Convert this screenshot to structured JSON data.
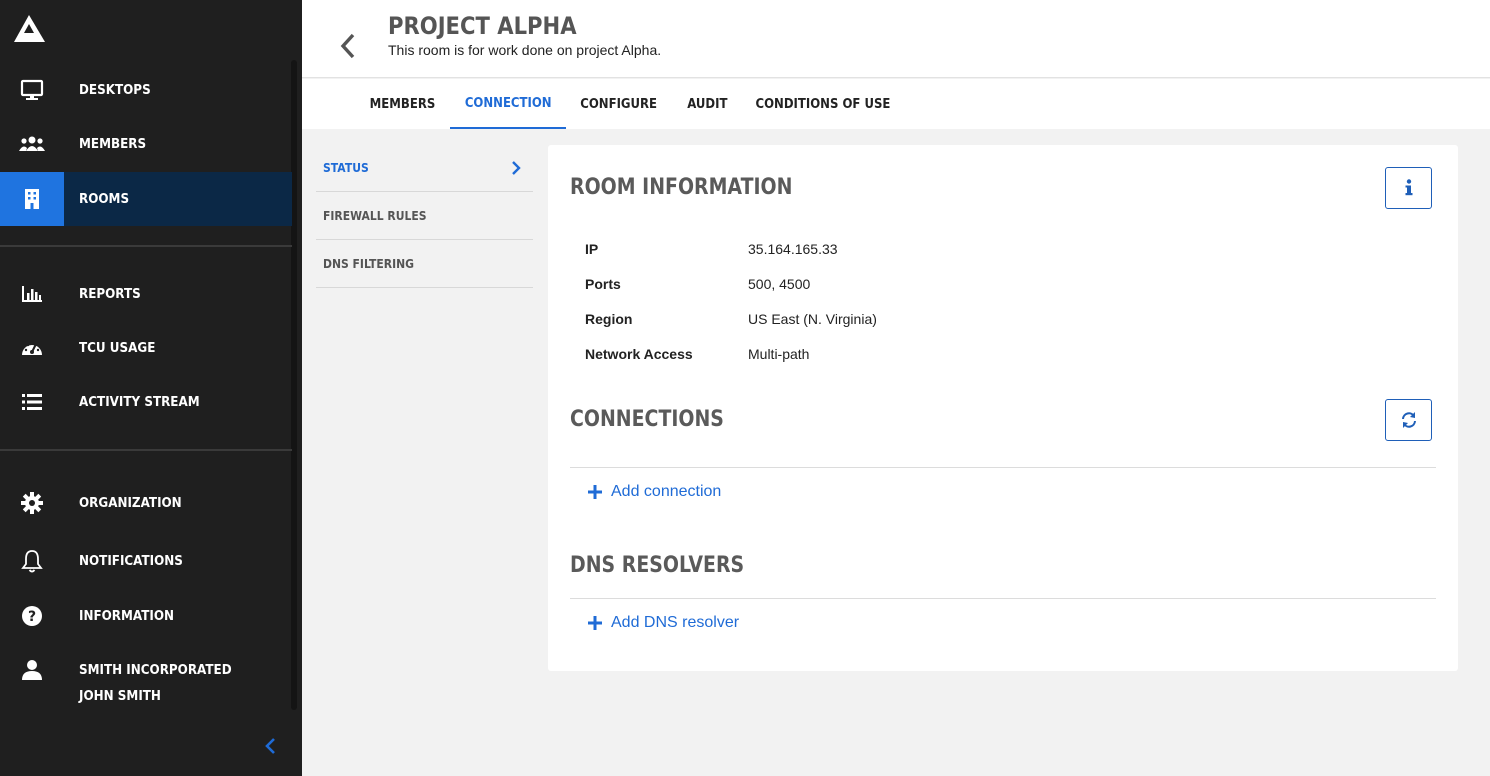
{
  "sidebar": {
    "logo": "logo-mountain-icon",
    "items": [
      {
        "label": "DESKTOPS",
        "icon": "monitor-icon"
      },
      {
        "label": "MEMBERS",
        "icon": "users-icon"
      },
      {
        "label": "ROOMS",
        "icon": "building-icon",
        "active": true
      },
      {
        "label": "REPORTS",
        "icon": "bar-chart-icon"
      },
      {
        "label": "TCU USAGE",
        "icon": "gauge-icon"
      },
      {
        "label": "ACTIVITY STREAM",
        "icon": "list-icon"
      },
      {
        "label": "ORGANIZATION",
        "icon": "gear-icon"
      },
      {
        "label": "NOTIFICATIONS",
        "icon": "bell-icon"
      },
      {
        "label": "INFORMATION",
        "icon": "question-circle-icon"
      }
    ],
    "user": {
      "organization": "SMITH INCORPORATED",
      "name": "JOHN SMITH",
      "icon": "user-icon"
    }
  },
  "header": {
    "title": "PROJECT ALPHA",
    "subtitle": "This room is for work done on project Alpha."
  },
  "tabs": [
    {
      "label": "MEMBERS"
    },
    {
      "label": "CONNECTION",
      "active": true
    },
    {
      "label": "CONFIGURE"
    },
    {
      "label": "AUDIT"
    },
    {
      "label": "CONDITIONS OF USE"
    }
  ],
  "subnav": [
    {
      "label": "STATUS",
      "active": true
    },
    {
      "label": "FIREWALL RULES"
    },
    {
      "label": "DNS FILTERING"
    }
  ],
  "room_information": {
    "title": "ROOM INFORMATION",
    "rows": [
      {
        "key": "IP",
        "value": "35.164.165.33"
      },
      {
        "key": "Ports",
        "value": "500, 4500"
      },
      {
        "key": "Region",
        "value": "US East (N. Virginia)"
      },
      {
        "key": "Network Access",
        "value": "Multi-path"
      }
    ]
  },
  "connections": {
    "title": "CONNECTIONS",
    "add_label": "Add connection"
  },
  "dns_resolvers": {
    "title": "DNS RESOLVERS",
    "add_label": "Add DNS resolver"
  },
  "colors": {
    "accent": "#1f6bd6",
    "sidebar_bg": "#1f1f1f",
    "sidebar_active_bg": "#0b2846",
    "sidebar_active_icon_bg": "#1f74e0"
  }
}
